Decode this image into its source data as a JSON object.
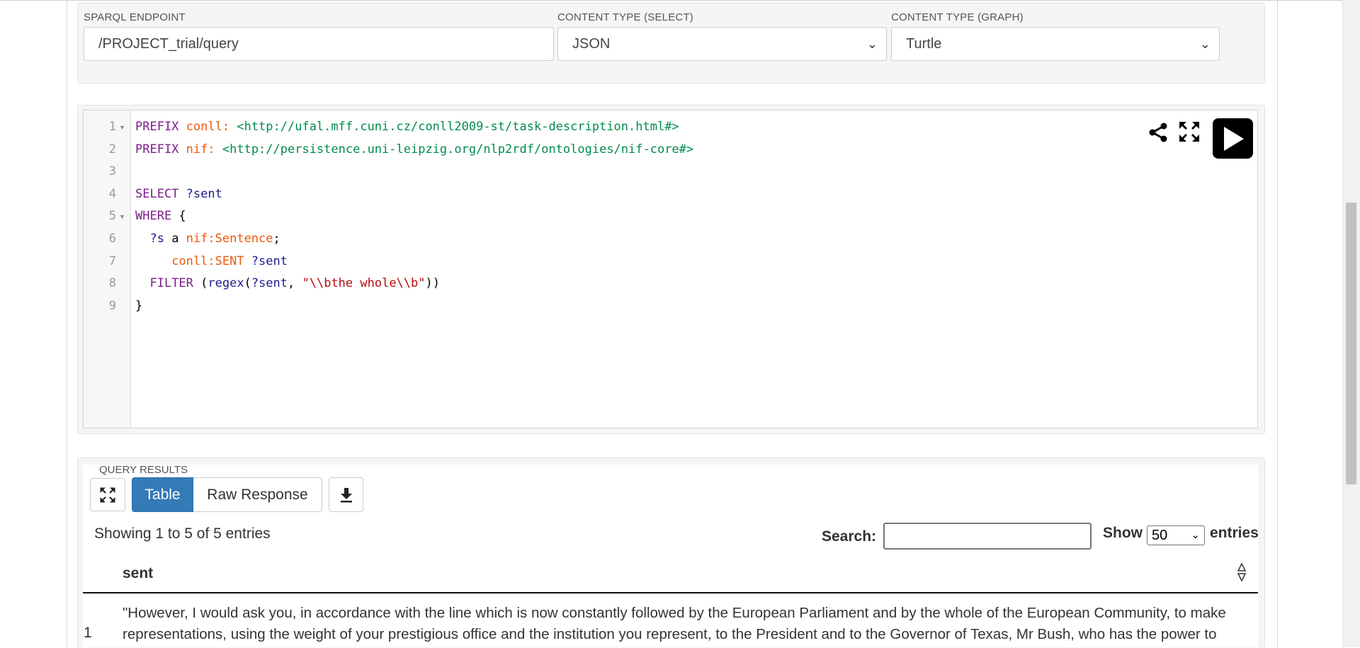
{
  "endpoint": {
    "sparql_label": "SPARQL ENDPOINT",
    "sparql_value": "/PROJECT_trial/query",
    "select_label": "CONTENT TYPE (SELECT)",
    "select_value": "JSON",
    "graph_label": "CONTENT TYPE (GRAPH)",
    "graph_value": "Turtle"
  },
  "editor": {
    "line_numbers": [
      "1",
      "2",
      "3",
      "4",
      "5",
      "6",
      "7",
      "8",
      "9"
    ],
    "lines": [
      [
        {
          "t": "PREFIX",
          "c": "kw"
        },
        {
          "t": " "
        },
        {
          "t": "conll:",
          "c": "pfx"
        },
        {
          "t": " "
        },
        {
          "t": "<http://ufal.mff.cuni.cz/conll2009-st/task-description.html#>",
          "c": "uri"
        }
      ],
      [
        {
          "t": "PREFIX",
          "c": "kw"
        },
        {
          "t": " "
        },
        {
          "t": "nif:",
          "c": "pfx"
        },
        {
          "t": " "
        },
        {
          "t": "<http://persistence.uni-leipzig.org/nlp2rdf/ontologies/nif-core#>",
          "c": "uri"
        }
      ],
      [],
      [
        {
          "t": "SELECT",
          "c": "kw"
        },
        {
          "t": " "
        },
        {
          "t": "?sent",
          "c": "var"
        }
      ],
      [
        {
          "t": "WHERE",
          "c": "kw"
        },
        {
          "t": " {"
        }
      ],
      [
        {
          "t": "  "
        },
        {
          "t": "?s",
          "c": "var"
        },
        {
          "t": " a "
        },
        {
          "t": "nif:Sentence",
          "c": "pfx"
        },
        {
          "t": ";"
        }
      ],
      [
        {
          "t": "     "
        },
        {
          "t": "conll:SENT",
          "c": "pfx"
        },
        {
          "t": " "
        },
        {
          "t": "?sent",
          "c": "var"
        }
      ],
      [
        {
          "t": "  "
        },
        {
          "t": "FILTER",
          "c": "kw"
        },
        {
          "t": " ("
        },
        {
          "t": "regex",
          "c": "fn"
        },
        {
          "t": "("
        },
        {
          "t": "?sent",
          "c": "var"
        },
        {
          "t": ", "
        },
        {
          "t": "\"\\\\bthe whole\\\\b\"",
          "c": "str"
        },
        {
          "t": "))"
        }
      ],
      [
        {
          "t": "}"
        }
      ]
    ],
    "toolbar_icons": [
      "share-icon",
      "fullscreen-icon",
      "play-icon"
    ]
  },
  "results": {
    "label": "QUERY RESULTS",
    "tab_table": "Table",
    "tab_raw": "Raw Response",
    "info": "Showing 1 to 5 of 5 entries",
    "search_label": "Search:",
    "search_value": "",
    "show_label": "Show",
    "show_value": "50",
    "entries_label": "entries",
    "column": "sent",
    "rows": [
      {
        "num": "1",
        "sent": "\"However, I would ask you, in accordance with the line which is now constantly followed by the European Parliament and by the whole of the European Community, to make representations, using the weight of your prestigious office and the institution you represent, to the President and to the Governor of Texas, Mr Bush, who has the power to"
      }
    ]
  },
  "colors": {
    "primary": "#337ab7",
    "keyword": "#7c1d8a",
    "prefix": "#e9590f",
    "uri": "#008b4a"
  }
}
